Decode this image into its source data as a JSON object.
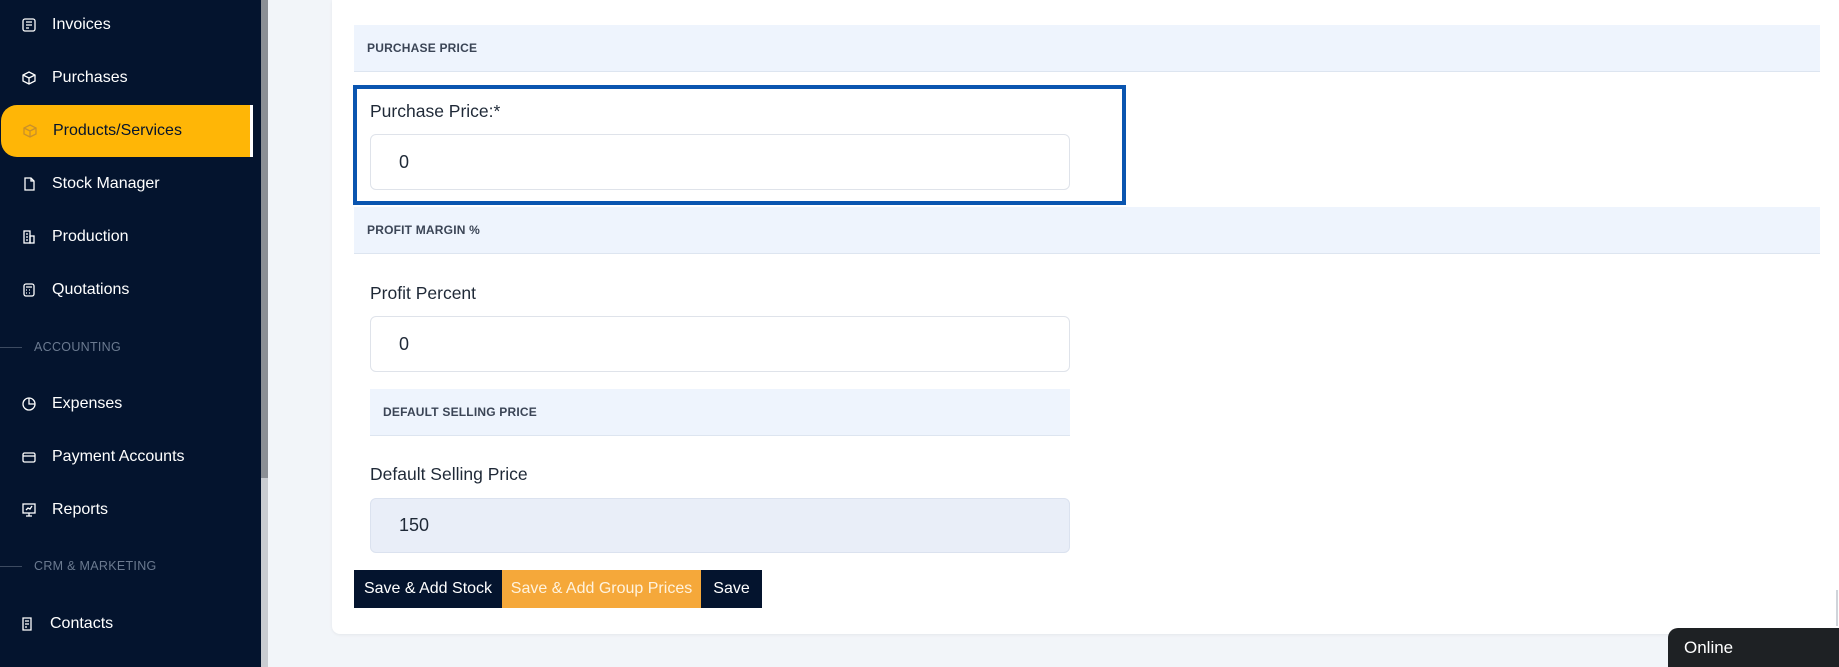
{
  "sidebar": {
    "items": [
      {
        "label": "Invoices",
        "icon": "invoice-icon"
      },
      {
        "label": "Purchases",
        "icon": "box-icon"
      },
      {
        "label": "Products/Services",
        "icon": "cube-icon",
        "active": true
      },
      {
        "label": "Stock Manager",
        "icon": "file-icon"
      },
      {
        "label": "Production",
        "icon": "building-icon"
      },
      {
        "label": "Quotations",
        "icon": "calculator-icon"
      },
      {
        "label": "Expenses",
        "icon": "pie-icon"
      },
      {
        "label": "Payment Accounts",
        "icon": "card-icon"
      },
      {
        "label": "Reports",
        "icon": "presentation-icon"
      },
      {
        "label": "Contacts",
        "icon": "document-icon"
      }
    ],
    "sections": {
      "accounting": "ACCOUNTING",
      "crm": "CRM & MARKETING"
    }
  },
  "form": {
    "purchase_section": "PURCHASE PRICE",
    "purchase_label": "Purchase Price:*",
    "purchase_value": "0",
    "profit_section": "PROFIT MARGIN %",
    "profit_label": "Profit Percent",
    "profit_value": "0",
    "selling_section": "DEFAULT SELLING PRICE",
    "selling_label": "Default Selling Price",
    "selling_value": "150"
  },
  "buttons": {
    "save_add_stock": "Save & Add Stock",
    "save_group_prices": "Save & Add Group Prices",
    "save": "Save"
  },
  "status": {
    "online": "Online"
  },
  "colors": {
    "sidebar_bg": "#04142e",
    "active_bg": "#ffb606",
    "section_bg": "#eef4fd",
    "highlight_border": "#0a55b0",
    "orange_button": "#f5a83a"
  }
}
